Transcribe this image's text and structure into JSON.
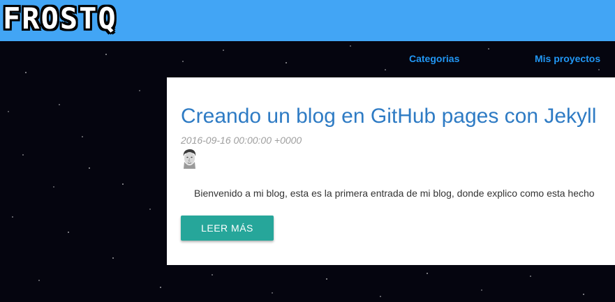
{
  "header": {
    "logo_text": "FROSTQ",
    "background_color": "#42a5f5"
  },
  "nav": {
    "items": [
      {
        "label": "Categorias"
      },
      {
        "label": "Mis proyectos"
      }
    ],
    "link_color": "#2196f3"
  },
  "post": {
    "title": "Creando un blog en GitHub pages con Jekyll",
    "date": "2016-09-16 00:00:00 +0000",
    "excerpt": "Bienvenido a mi blog, esta es la primera entrada de mi blog, donde explico como esta hecho",
    "read_more_label": "LEER MÁS",
    "avatar_icon": "author-avatar-icon"
  },
  "colors": {
    "page_background": "#05050f",
    "card_background": "#ffffff",
    "title_color": "#2e7bc4",
    "button_color": "#26a69a"
  }
}
